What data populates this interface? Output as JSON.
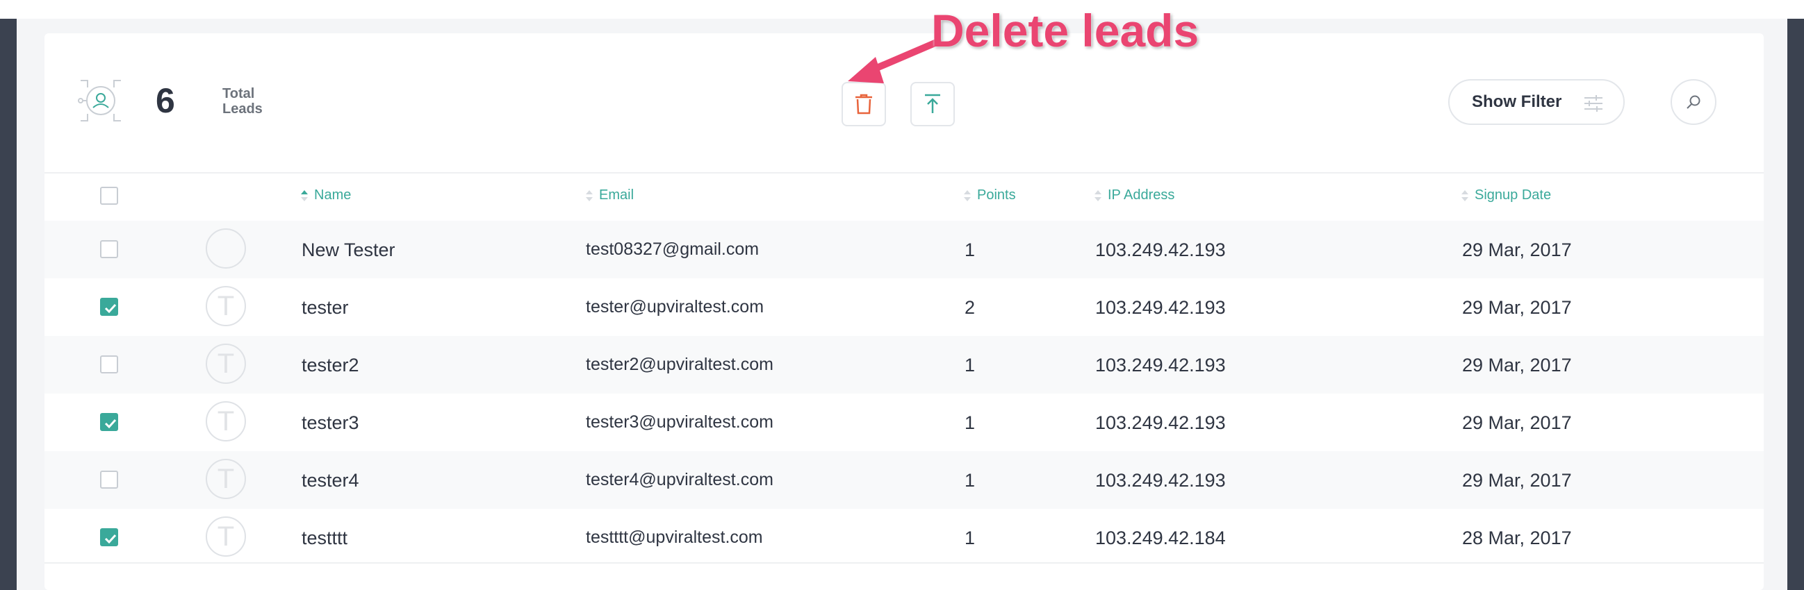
{
  "header": {
    "total_count": "6",
    "total_label": "Total Leads",
    "show_filter_label": "Show Filter"
  },
  "annotation": {
    "text": "Delete leads",
    "color": "#ea4571"
  },
  "columns": {
    "name": "Name",
    "email": "Email",
    "points": "Points",
    "ip": "IP Address",
    "signup": "Signup Date"
  },
  "rows": [
    {
      "avatar": "",
      "name": "New Tester",
      "email": "test08327@gmail.com",
      "points": "1",
      "ip": "103.249.42.193",
      "signup": "29 Mar, 2017",
      "checked": false
    },
    {
      "avatar": "T",
      "name": "tester",
      "email": "tester@upviraltest.com",
      "points": "2",
      "ip": "103.249.42.193",
      "signup": "29 Mar, 2017",
      "checked": true
    },
    {
      "avatar": "T",
      "name": "tester2",
      "email": "tester2@upviraltest.com",
      "points": "1",
      "ip": "103.249.42.193",
      "signup": "29 Mar, 2017",
      "checked": false
    },
    {
      "avatar": "T",
      "name": "tester3",
      "email": "tester3@upviraltest.com",
      "points": "1",
      "ip": "103.249.42.193",
      "signup": "29 Mar, 2017",
      "checked": true
    },
    {
      "avatar": "T",
      "name": "tester4",
      "email": "tester4@upviraltest.com",
      "points": "1",
      "ip": "103.249.42.193",
      "signup": "29 Mar, 2017",
      "checked": false
    },
    {
      "avatar": "T",
      "name": "testttt",
      "email": "testttt@upviraltest.com",
      "points": "1",
      "ip": "103.249.42.184",
      "signup": "28 Mar, 2017",
      "checked": true
    }
  ],
  "colors": {
    "accent": "#3aa99a",
    "delete": "#e8643c",
    "sidebar": "#3b4250"
  }
}
